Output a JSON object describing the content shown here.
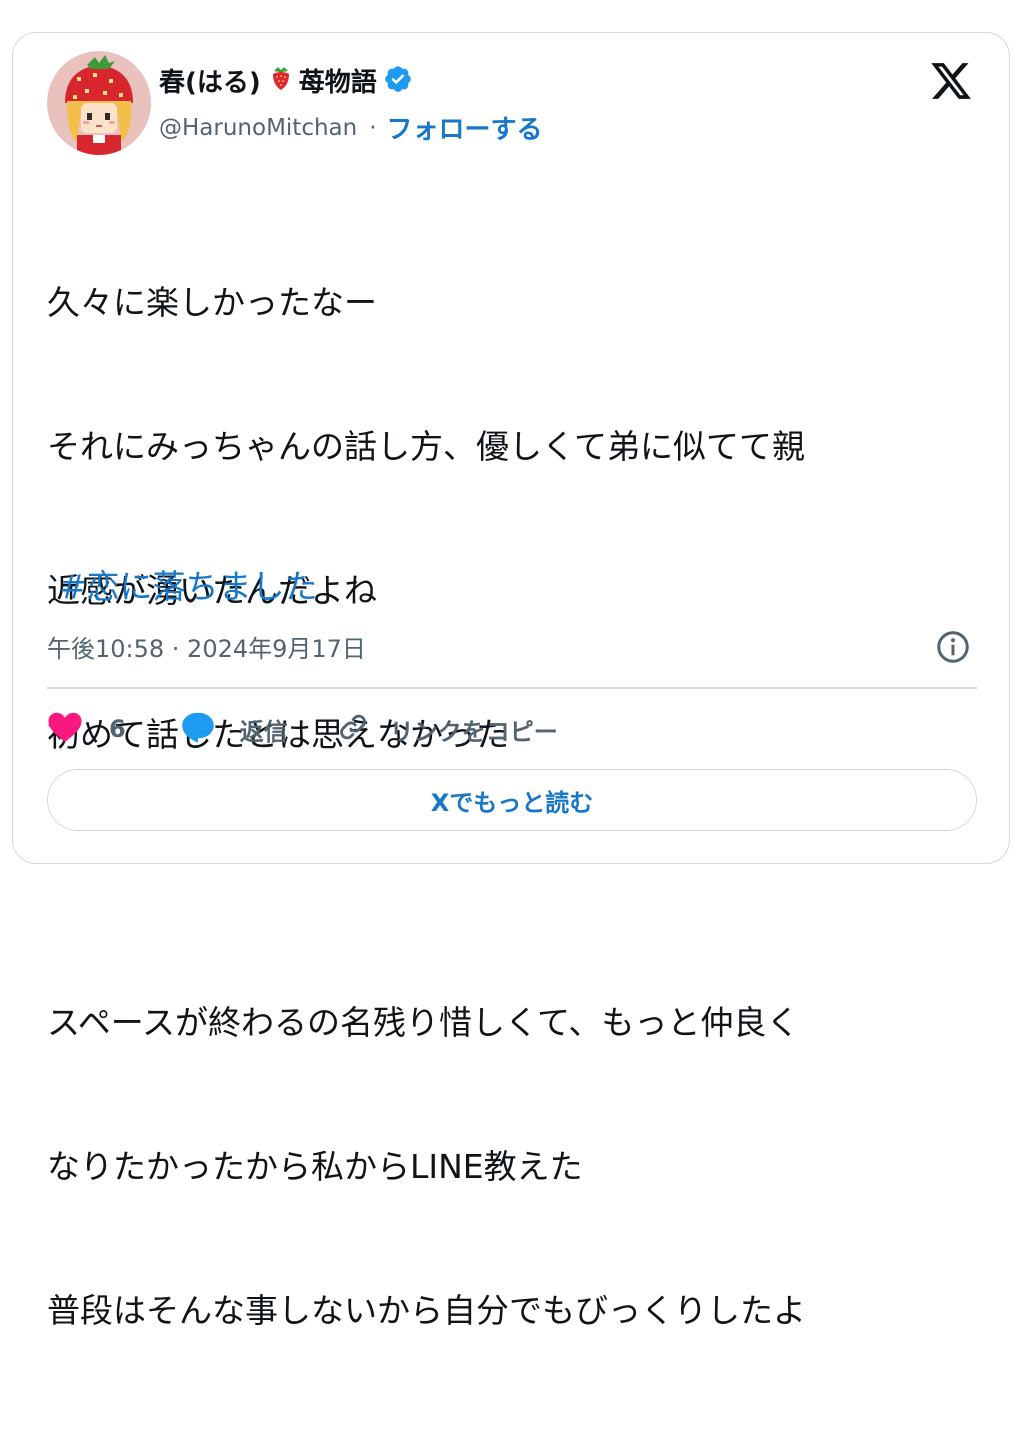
{
  "author": {
    "display_name_part1": "春(はる)",
    "display_name_part2": "苺物語",
    "handle": "@HarunoMitchan",
    "separator": "·",
    "follow_label": "フォローする",
    "emoji_icon": "strawberry-icon",
    "badge_icon": "verified-badge-icon",
    "avatar": "pixel-art-girl-strawberry-hat"
  },
  "tweet": {
    "lines": [
      "久々に楽しかったなー",
      "それにみっちゃんの話し方、優しくて弟に似てて親",
      "近感が湧いたんだよね",
      "初めて話したとは思えなかった",
      "",
      "スペースが終わるの名残り惜しくて、もっと仲良く",
      "なりたかったから私からLINE教えた",
      "普段はそんな事しないから自分でもびっくりしたよ"
    ],
    "hashtag": "#恋に落ちました",
    "timestamp": "午後10:58 · 2024年9月17日"
  },
  "actions": {
    "like_count": "6",
    "reply_label": "返信",
    "copy_link_label": "リンクをコピー"
  },
  "read_more_label": "Xでもっと読む",
  "colors": {
    "link": "#1877c8",
    "verified": "#1d9bf0",
    "like": "#f91880",
    "muted": "#536471",
    "border": "#cfd9de",
    "text": "#0f1419"
  }
}
